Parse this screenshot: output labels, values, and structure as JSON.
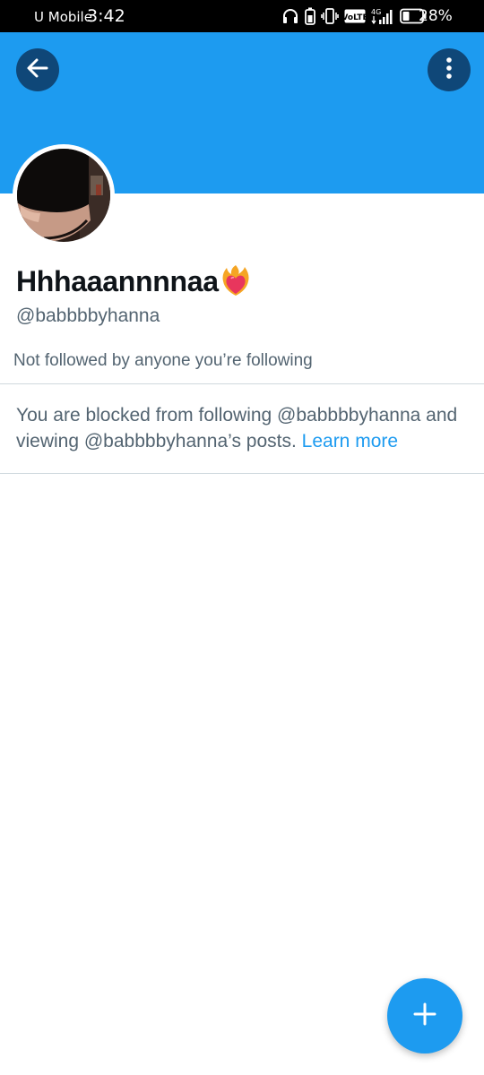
{
  "status_bar": {
    "carrier": "U Mobile",
    "time": "3:42",
    "network_badge": "VoLTE",
    "network_type": "4G",
    "battery_percent": "28%",
    "icons": [
      "headphones-icon",
      "battery-saver-icon",
      "vibrate-icon",
      "volte-icon",
      "signal-icon",
      "battery-icon"
    ]
  },
  "header": {
    "banner_color": "#1d9bf0",
    "back_icon": "arrow-left-icon",
    "more_icon": "more-vertical-icon"
  },
  "profile": {
    "display_name": "Hhhaaannnnaa",
    "name_emoji_icon": "heart-on-fire-icon",
    "handle": "@babbbbyhanna",
    "followers_note": "Not followed by anyone you’re following"
  },
  "blocked_notice": {
    "text": "You are blocked from following @babbbbyhanna and viewing @babbbbyhanna’s posts.",
    "link_label": "Learn more",
    "link_color": "#1d9bf0"
  },
  "compose": {
    "icon": "plus-icon",
    "color": "#1d9bf0"
  }
}
